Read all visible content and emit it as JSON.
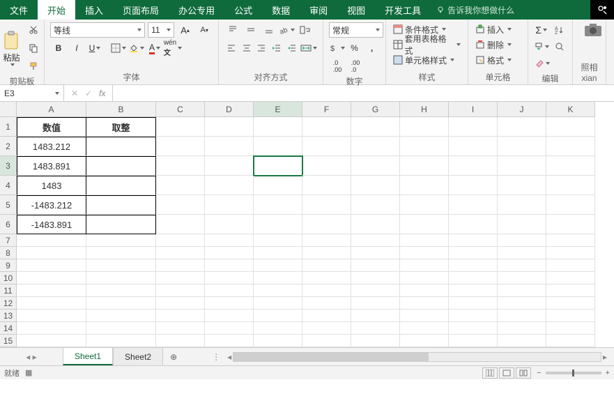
{
  "menu": {
    "file": "文件",
    "home": "开始",
    "insert": "插入",
    "layout": "页面布局",
    "office": "办公专用",
    "formula": "公式",
    "data": "数据",
    "review": "审阅",
    "view": "视图",
    "dev": "开发工具",
    "tell": "告诉我你想做什么"
  },
  "ribbon": {
    "clipboard": {
      "paste": "粘贴",
      "label": "剪贴板"
    },
    "font": {
      "name": "等线",
      "size": "11",
      "label": "字体"
    },
    "align": {
      "label": "对齐方式"
    },
    "number": {
      "format": "常规",
      "label": "数字"
    },
    "styles": {
      "cond": "条件格式",
      "table": "套用表格格式",
      "cell": "单元格样式",
      "label": "样式"
    },
    "cells": {
      "insert": "插入",
      "delete": "删除",
      "format": "格式",
      "label": "单元格"
    },
    "edit": {
      "label": "编辑"
    },
    "camera": {
      "label1": "照相",
      "label2": "xian"
    }
  },
  "namebox": "E3",
  "fx": "fx",
  "headers": {
    "a": "数值",
    "b": "取整"
  },
  "values": {
    "a2": "1483.212",
    "a3": "1483.891",
    "a4": "1483",
    "a5": "-1483.212",
    "a6": "-1483.891"
  },
  "cols": [
    "A",
    "B",
    "C",
    "D",
    "E",
    "F",
    "G",
    "H",
    "I",
    "J",
    "K"
  ],
  "sheets": {
    "s1": "Sheet1",
    "s2": "Sheet2"
  },
  "status": "就绪"
}
